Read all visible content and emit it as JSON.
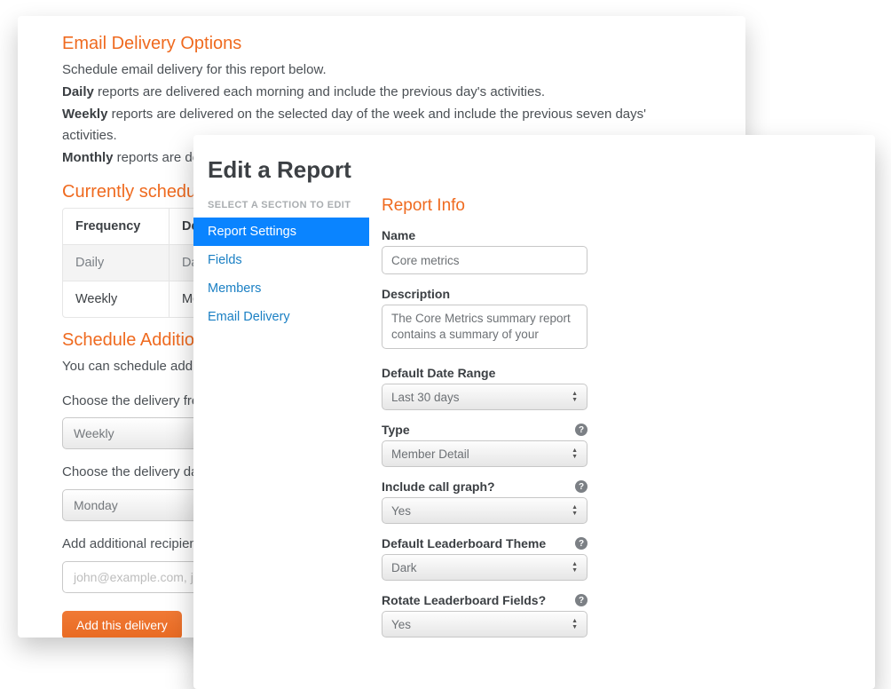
{
  "back": {
    "heading1": "Email Delivery Options",
    "intro": "Schedule email delivery for this report below.",
    "line_daily_bold": "Daily",
    "line_daily_rest": " reports are delivered each morning and include the previous day's activities.",
    "line_weekly_bold": "Weekly",
    "line_weekly_rest": " reports are delivered on the selected day of the week and include the previous seven days' activities.",
    "line_monthly_bold": "Monthly",
    "line_monthly_rest": " reports are del",
    "heading2": "Currently schedule",
    "col1": "Frequency",
    "col2": "De",
    "row1a": "Daily",
    "row1b": "Da",
    "row2a": "Weekly",
    "row2b": "Mo",
    "heading3": "Schedule Addition",
    "sched_text": "You can schedule additi",
    "label_freq": "Choose the delivery frequ",
    "val_freq": "Weekly",
    "label_day": "Choose the delivery day:",
    "val_day": "Monday",
    "label_recip": "Add additional recipients,",
    "placeholder_recip": "john@example.com, jane",
    "btn_add": "Add this delivery"
  },
  "front": {
    "title": "Edit a Report",
    "side_head": "SELECT A SECTION TO EDIT",
    "side_items": [
      "Report Settings",
      "Fields",
      "Members",
      "Email Delivery"
    ],
    "section": "Report Info",
    "lbl_name": "Name",
    "val_name": "Core metrics",
    "lbl_desc": "Description",
    "val_desc": "The Core Metrics summary report contains a summary of your",
    "lbl_range": "Default Date Range",
    "val_range": "Last 30 days",
    "lbl_type": "Type",
    "val_type": "Member Detail",
    "lbl_graph": "Include call graph?",
    "val_graph": "Yes",
    "lbl_theme": "Default Leaderboard Theme",
    "val_theme": "Dark",
    "lbl_rotate": "Rotate Leaderboard Fields?",
    "val_rotate": "Yes"
  }
}
